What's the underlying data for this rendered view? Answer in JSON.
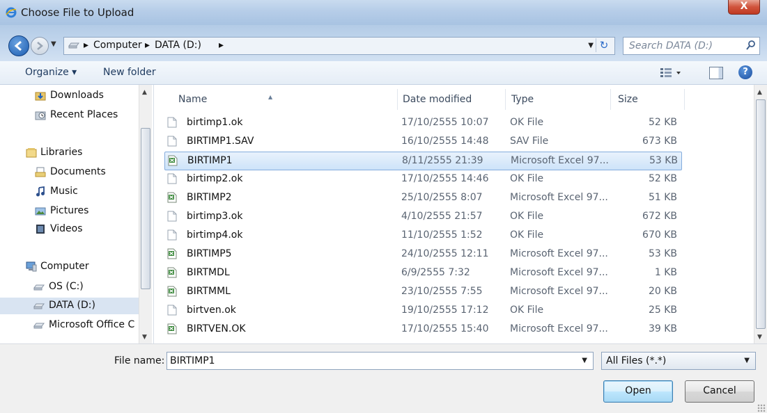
{
  "window": {
    "title": "Choose File to Upload",
    "close_label": "X"
  },
  "address": {
    "crumbs": [
      "Computer",
      "DATA (D:)"
    ],
    "separator": "▸",
    "search_placeholder": "Search DATA (D:)"
  },
  "toolbar": {
    "organize_label": "Organize ▾",
    "new_folder_label": "New folder",
    "help_label": "?"
  },
  "nav": {
    "items": [
      {
        "label": "Downloads",
        "icon": "downloads-icon",
        "group": "favorites"
      },
      {
        "label": "Recent Places",
        "icon": "recent-places-icon",
        "group": "favorites"
      },
      {
        "label": "Libraries",
        "icon": "libraries-icon",
        "group": "libraries"
      },
      {
        "label": "Documents",
        "icon": "documents-icon",
        "group": "libraries"
      },
      {
        "label": "Music",
        "icon": "music-icon",
        "group": "libraries"
      },
      {
        "label": "Pictures",
        "icon": "pictures-icon",
        "group": "libraries"
      },
      {
        "label": "Videos",
        "icon": "videos-icon",
        "group": "libraries"
      },
      {
        "label": "Computer",
        "icon": "computer-icon",
        "group": "computer"
      },
      {
        "label": "OS (C:)",
        "icon": "drive-icon",
        "group": "computer"
      },
      {
        "label": "DATA (D:)",
        "icon": "drive-icon",
        "group": "computer",
        "selected": true
      },
      {
        "label": "Microsoft Office C",
        "icon": "drive-icon",
        "group": "computer"
      }
    ]
  },
  "files": {
    "columns": {
      "name": "Name",
      "date": "Date modified",
      "type": "Type",
      "size": "Size"
    },
    "rows": [
      {
        "name": "birtimp1.ok",
        "date": "17/10/2555 10:07",
        "type": "OK File",
        "size": "52 KB",
        "icon": "generic-file-icon"
      },
      {
        "name": "BIRTIMP1.SAV",
        "date": "16/10/2555 14:48",
        "type": "SAV File",
        "size": "673 KB",
        "icon": "generic-file-icon"
      },
      {
        "name": "BIRTIMP1",
        "date": "8/11/2555 21:39",
        "type": "Microsoft Excel 97...",
        "size": "53 KB",
        "icon": "excel-file-icon",
        "selected": true
      },
      {
        "name": "birtimp2.ok",
        "date": "17/10/2555 14:46",
        "type": "OK File",
        "size": "52 KB",
        "icon": "generic-file-icon"
      },
      {
        "name": "BIRTIMP2",
        "date": "25/10/2555 8:07",
        "type": "Microsoft Excel 97...",
        "size": "51 KB",
        "icon": "excel-file-icon"
      },
      {
        "name": "birtimp3.ok",
        "date": "4/10/2555 21:57",
        "type": "OK File",
        "size": "672 KB",
        "icon": "generic-file-icon"
      },
      {
        "name": "birtimp4.ok",
        "date": "11/10/2555 1:52",
        "type": "OK File",
        "size": "670 KB",
        "icon": "generic-file-icon"
      },
      {
        "name": "BIRTIMP5",
        "date": "24/10/2555 12:11",
        "type": "Microsoft Excel 97...",
        "size": "53 KB",
        "icon": "excel-file-icon"
      },
      {
        "name": "BIRTMDL",
        "date": "6/9/2555 7:32",
        "type": "Microsoft Excel 97...",
        "size": "1 KB",
        "icon": "excel-file-icon"
      },
      {
        "name": "BIRTMML",
        "date": "23/10/2555 7:55",
        "type": "Microsoft Excel 97...",
        "size": "20 KB",
        "icon": "excel-file-icon"
      },
      {
        "name": "birtven.ok",
        "date": "19/10/2555 17:12",
        "type": "OK File",
        "size": "25 KB",
        "icon": "generic-file-icon"
      },
      {
        "name": "BIRTVEN.OK",
        "date": "17/10/2555 15:40",
        "type": "Microsoft Excel 97...",
        "size": "39 KB",
        "icon": "excel-file-icon"
      }
    ]
  },
  "bottom": {
    "filename_label": "File name:",
    "filename_value": "BIRTIMP1",
    "filter_value": "All Files (*.*)",
    "open_label": "Open",
    "cancel_label": "Cancel"
  },
  "colors": {
    "accent": "#1b5cb0",
    "selection": "#cde3f9",
    "close": "#c03a22"
  }
}
